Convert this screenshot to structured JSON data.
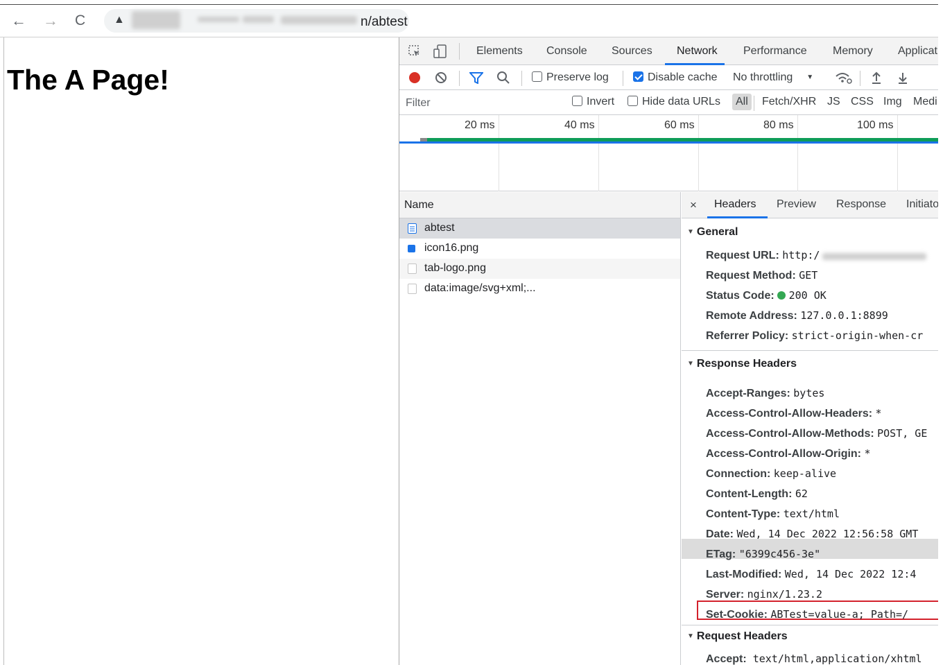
{
  "browser": {
    "back": "←",
    "forward": "→",
    "reload": "C",
    "warning": "▲",
    "url_suffix": "n/abtest"
  },
  "page": {
    "heading": "The A Page!"
  },
  "devtools": {
    "tabs": [
      "Elements",
      "Console",
      "Sources",
      "Network",
      "Performance",
      "Memory",
      "Applicat"
    ],
    "toolbar": {
      "preserve_log": "Preserve log",
      "disable_cache": "Disable cache",
      "throttling": "No throttling",
      "dropdown": "▼"
    },
    "filterbar": {
      "filter_placeholder": "Filter",
      "invert": "Invert",
      "hide_data_urls": "Hide data URLs",
      "types": [
        "All",
        "Fetch/XHR",
        "JS",
        "CSS",
        "Img",
        "Medi"
      ]
    },
    "timeline": {
      "ticks": [
        "20 ms",
        "40 ms",
        "60 ms",
        "80 ms",
        "100 ms"
      ]
    },
    "requests": {
      "header": "Name",
      "rows": [
        "abtest",
        "icon16.png",
        "tab-logo.png",
        "data:image/svg+xml;..."
      ]
    },
    "details": {
      "close": "×",
      "tabs": [
        "Headers",
        "Preview",
        "Response",
        "Initiato"
      ],
      "general_title": "General",
      "general": [
        {
          "k": "Request URL:",
          "v": "http:/"
        },
        {
          "k": "Request Method:",
          "v": "GET"
        },
        {
          "k": "Status Code:",
          "v": "200 OK"
        },
        {
          "k": "Remote Address:",
          "v": "127.0.0.1:8899"
        },
        {
          "k": "Referrer Policy:",
          "v": "strict-origin-when-cr"
        }
      ],
      "response_title": "Response Headers",
      "response": [
        {
          "k": "Accept-Ranges:",
          "v": "bytes"
        },
        {
          "k": "Access-Control-Allow-Headers:",
          "v": "*"
        },
        {
          "k": "Access-Control-Allow-Methods:",
          "v": "POST, GE"
        },
        {
          "k": "Access-Control-Allow-Origin:",
          "v": "*"
        },
        {
          "k": "Connection:",
          "v": "keep-alive"
        },
        {
          "k": "Content-Length:",
          "v": "62"
        },
        {
          "k": "Content-Type:",
          "v": "text/html"
        },
        {
          "k": "Date:",
          "v": "Wed, 14 Dec 2022 12:56:58 GMT"
        },
        {
          "k": "ETag:",
          "v": "\"6399c456-3e\""
        },
        {
          "k": "Last-Modified:",
          "v": "Wed, 14 Dec 2022 12:4"
        },
        {
          "k": "Server:",
          "v": "nginx/1.23.2"
        },
        {
          "k": "Set-Cookie:",
          "v": "ABTest=value-a; Path=/"
        }
      ],
      "request_title": "Request Headers",
      "request": [
        {
          "k": "Accept:",
          "v": "text/html,application/xhtml"
        }
      ]
    },
    "colors": {
      "accent": "#1a73e8",
      "record": "#d93025",
      "status_ok": "#34a853",
      "highlight_border": "#d3212c"
    }
  }
}
